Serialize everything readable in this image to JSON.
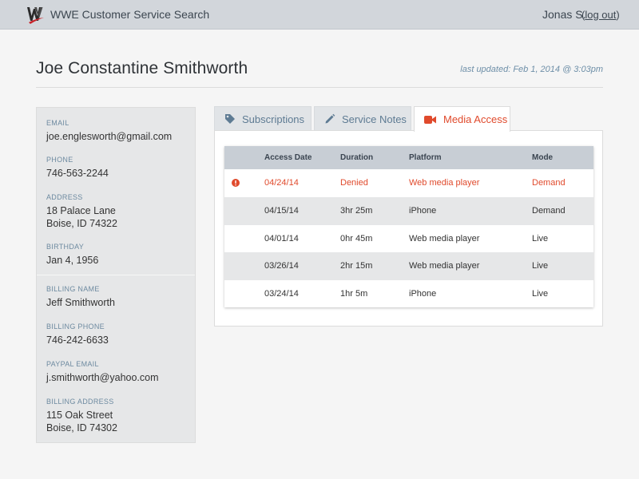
{
  "topbar": {
    "app_title": "WWE Customer Service Search",
    "user_name": "Jonas S.",
    "logout_prefix": "(",
    "logout_label": "log out",
    "logout_suffix": ")"
  },
  "customer": {
    "name": "Joe Constantine Smithworth",
    "last_updated": "last updated: Feb 1, 2014 @ 3:03pm"
  },
  "sidebar": {
    "email_label": "EMAIL",
    "email": "joe.englesworth@gmail.com",
    "phone_label": "PHONE",
    "phone": "746-563-2244",
    "address_label": "ADDRESS",
    "address_line1": "18 Palace Lane",
    "address_line2": "Boise, ID 74322",
    "birthday_label": "BIRTHDAY",
    "birthday": "Jan 4, 1956",
    "billing_name_label": "BILLING NAME",
    "billing_name": "Jeff Smithworth",
    "billing_phone_label": "BILLING PHONE",
    "billing_phone": "746-242-6633",
    "paypal_email_label": "PAYPAL EMAIL",
    "paypal_email": "j.smithworth@yahoo.com",
    "billing_address_label": "BILLING ADDRESS",
    "billing_address_line1": "115 Oak Street",
    "billing_address_line2": "Boise, ID 74302"
  },
  "tabs": [
    {
      "label": "Subscriptions",
      "icon": "tag-icon"
    },
    {
      "label": "Service Notes",
      "icon": "pencil-icon"
    },
    {
      "label": "Media Access",
      "icon": "video-camera-icon",
      "active": true
    }
  ],
  "media_table": {
    "headers": [
      "Access Date",
      "Duration",
      "Platform",
      "Mode"
    ],
    "rows": [
      {
        "date": "04/24/14",
        "duration": "Denied",
        "platform": "Web media player",
        "mode": "Demand",
        "status": "denied"
      },
      {
        "date": "04/15/14",
        "duration": "3hr 25m",
        "platform": "iPhone",
        "mode": "Demand",
        "status": "ok"
      },
      {
        "date": "04/01/14",
        "duration": "0hr 45m",
        "platform": "Web media player",
        "mode": "Live",
        "status": "ok"
      },
      {
        "date": "03/26/14",
        "duration": "2hr 15m",
        "platform": "Web media player",
        "mode": "Live",
        "status": "ok"
      },
      {
        "date": "03/24/14",
        "duration": "1hr 5m",
        "platform": "iPhone",
        "mode": "Live",
        "status": "ok"
      }
    ]
  },
  "colors": {
    "accent": "#e04a2c",
    "topbar_bg": "#d2d6db",
    "label_blue": "#6d8aa0",
    "tab_text": "#5e7b93"
  }
}
